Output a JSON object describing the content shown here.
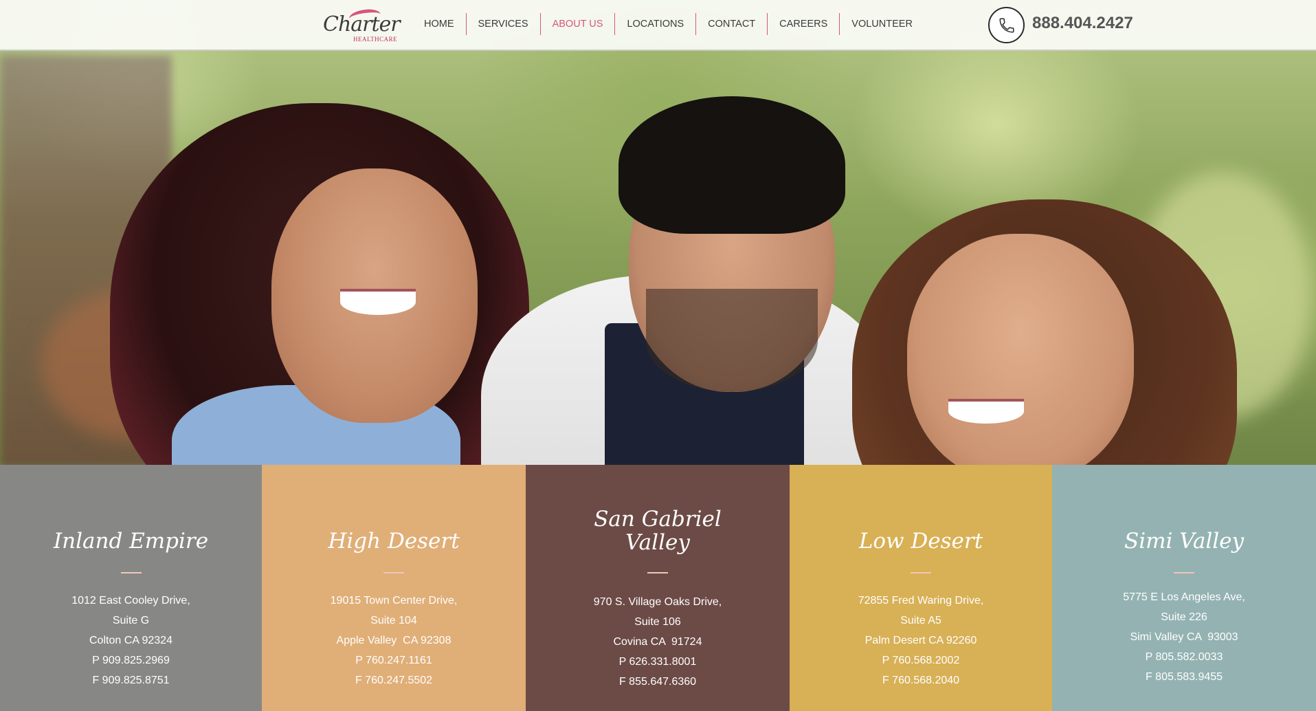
{
  "header": {
    "logo": {
      "script": "Charter",
      "sub": "HEALTHCARE"
    },
    "nav": [
      {
        "label": "HOME",
        "active": false
      },
      {
        "label": "SERVICES",
        "active": false
      },
      {
        "label": "ABOUT US",
        "active": true
      },
      {
        "label": "LOCATIONS",
        "active": false
      },
      {
        "label": "CONTACT",
        "active": false
      },
      {
        "label": "CAREERS",
        "active": false
      },
      {
        "label": "VOLUNTEER",
        "active": false
      }
    ],
    "phone_icon": "phone-icon",
    "phone": "888.404.2427"
  },
  "hero": {
    "image": "photo of three smiling healthcare workers outdoors"
  },
  "colors": {
    "accent": "#d4567e",
    "inland_empire": "#878886",
    "high_desert": "#e0ae77",
    "san_gabriel_valley": "#6c4b46",
    "low_desert": "#d8b055",
    "simi_valley": "#94b2b2"
  },
  "locations": [
    {
      "title_lines": [
        "Inland Empire"
      ],
      "lines": [
        "1012 East Cooley Drive,",
        "Suite G",
        "Colton CA 92324",
        "P 909.825.2969",
        "F 909.825.8751"
      ]
    },
    {
      "title_lines": [
        "High Desert"
      ],
      "lines": [
        "19015 Town Center Drive,",
        "Suite 104",
        "Apple Valley  CA 92308",
        "P 760.247.1161",
        "F 760.247.5502"
      ]
    },
    {
      "title_lines": [
        "San Gabriel",
        "Valley"
      ],
      "lines": [
        "970 S. Village Oaks Drive,",
        "Suite 106",
        "Covina CA  91724",
        "P 626.331.8001",
        "F 855.647.6360"
      ]
    },
    {
      "title_lines": [
        "Low Desert"
      ],
      "lines": [
        "72855 Fred Waring Drive,",
        "Suite A5",
        "Palm Desert CA 92260",
        "P 760.568.2002",
        "F 760.568.2040"
      ]
    },
    {
      "title_lines": [
        "Simi Valley"
      ],
      "lines": [
        "5775 E Los Angeles Ave,",
        "Suite 226",
        "Simi Valley CA  93003",
        "P 805.582.0033",
        "F 805.583.9455"
      ]
    }
  ]
}
